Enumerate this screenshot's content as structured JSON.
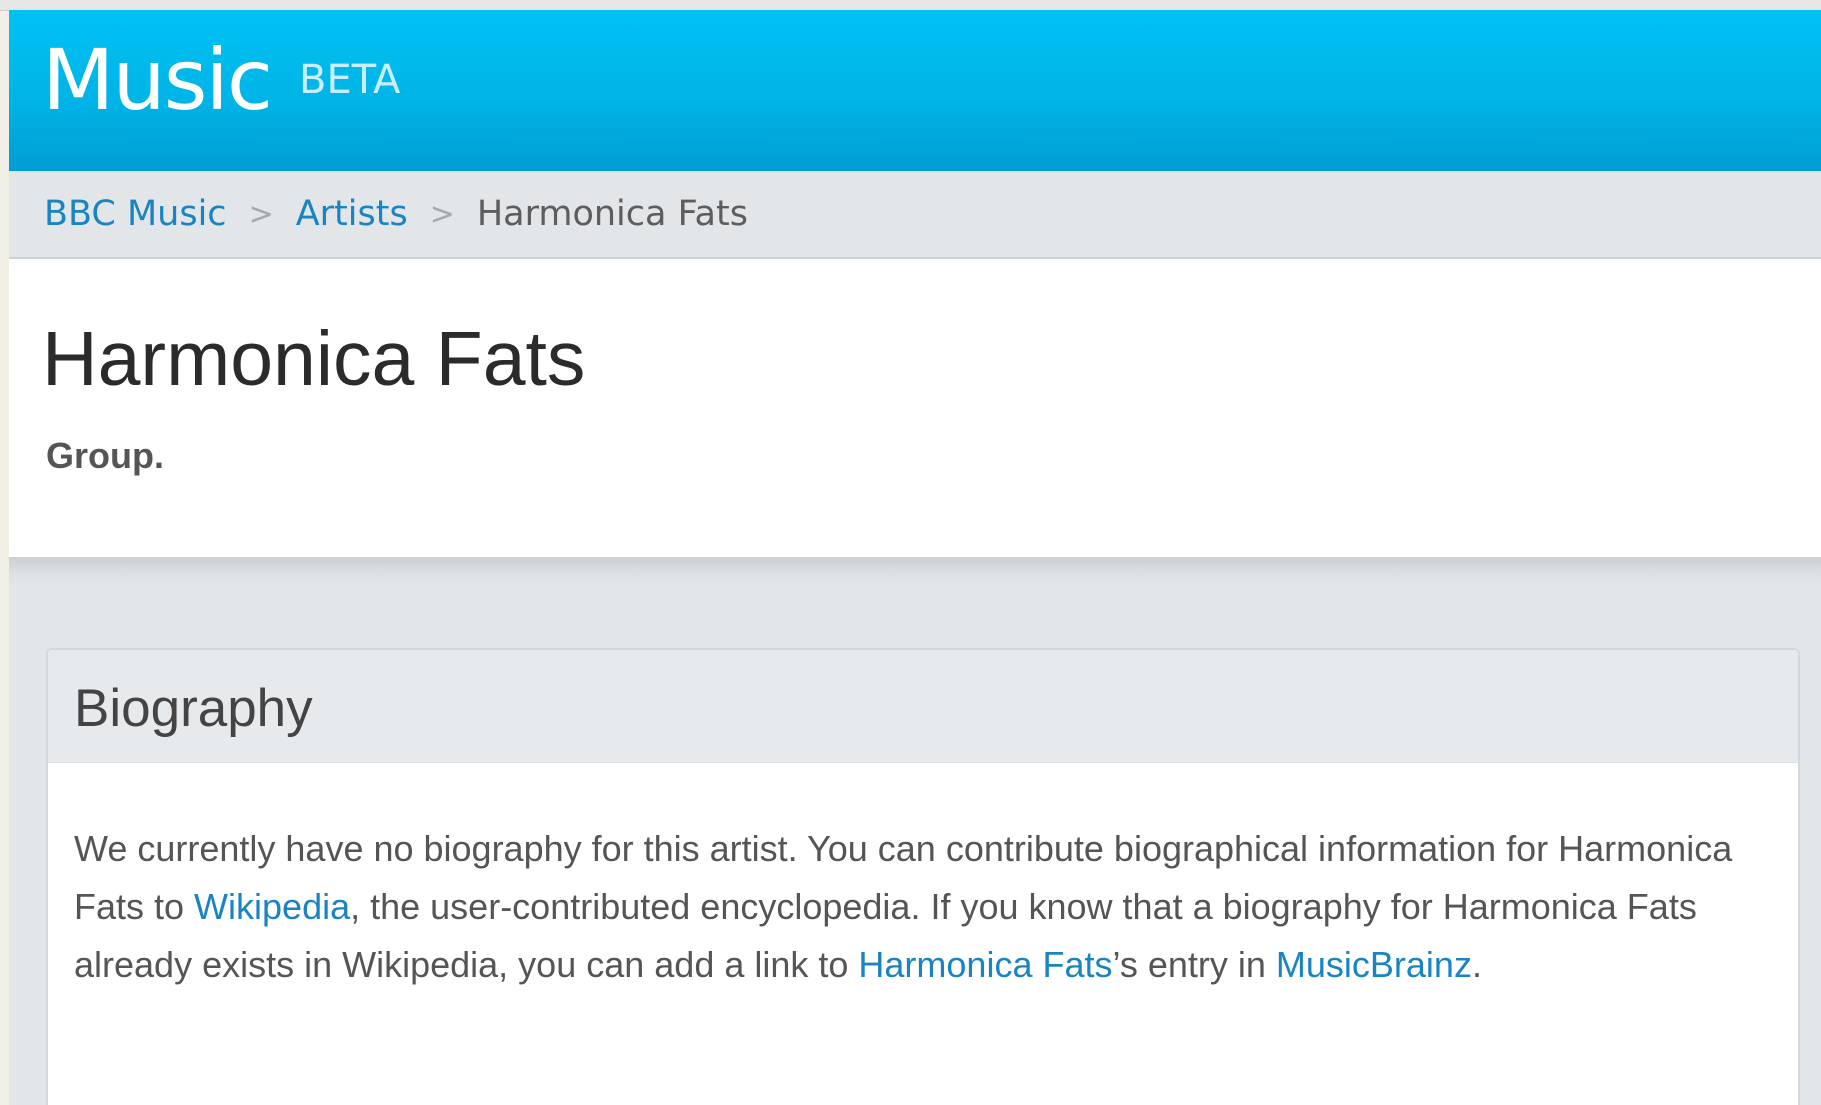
{
  "masthead": {
    "logo": "Music",
    "badge": "BETA"
  },
  "breadcrumb": {
    "items": [
      "BBC Music",
      "Artists",
      "Harmonica Fats"
    ],
    "separator": ">"
  },
  "artist": {
    "name": "Harmonica Fats",
    "type": "Group."
  },
  "biography": {
    "title": "Biography",
    "text_1": "We currently have no biography for this artist. You can contribute biographical information for Harmonica Fats to ",
    "link_wikipedia": "Wikipedia",
    "text_2": ", the user-contributed encyclopedia. If you know that a biography for Harmonica Fats already exists in Wikipedia, you can add a link to ",
    "link_artist": "Harmonica Fats",
    "text_3": "’s entry in ",
    "link_musicbrainz": "MusicBrainz",
    "text_4": "."
  },
  "colors": {
    "brand": "#00b4e7",
    "link": "#1a84c1"
  }
}
